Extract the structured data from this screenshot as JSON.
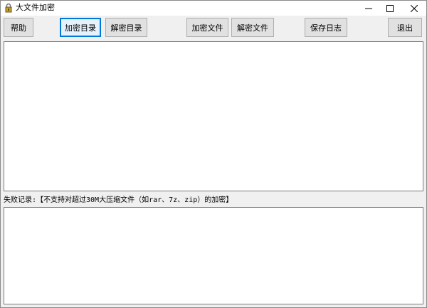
{
  "window": {
    "title": "大文件加密",
    "controls": {
      "minimize": "–",
      "maximize": "☐",
      "close": "✕"
    }
  },
  "toolbar": {
    "help": "帮助",
    "encrypt_dir": "加密目录",
    "decrypt_dir": "解密目录",
    "encrypt_file": "加密文件",
    "decrypt_file": "解密文件",
    "save_log": "保存日志",
    "exit": "退出"
  },
  "main_log": {
    "value": ""
  },
  "fail_section": {
    "label": "失败记录:【不支持对超过30M大压缩文件（如rar、7z、zip）的加密】",
    "value": ""
  },
  "colors": {
    "focus_border": "#0078d7",
    "button_face": "#e1e1e1",
    "window_bg": "#f0f0f0"
  }
}
